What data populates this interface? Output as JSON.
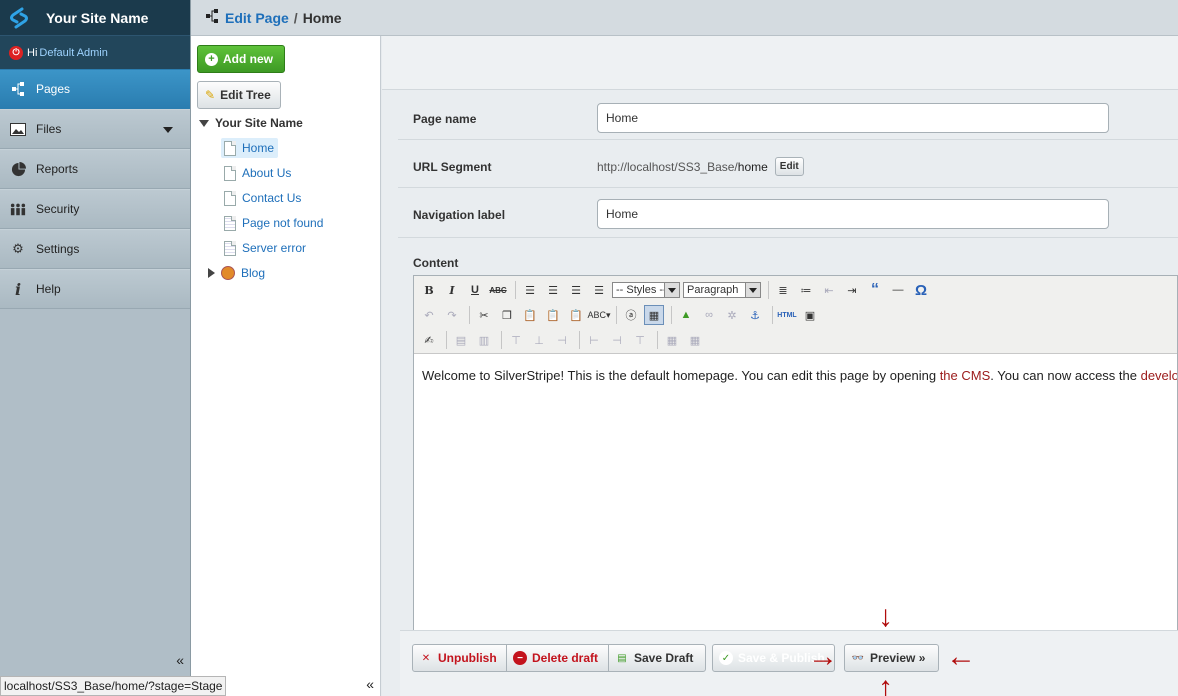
{
  "brand": {
    "site_name": "Your Site Name"
  },
  "user": {
    "greeting": "Hi",
    "name": "Default Admin"
  },
  "menu": [
    {
      "label": "Pages",
      "icon": "sitemap-icon",
      "active": true
    },
    {
      "label": "Files",
      "icon": "image-icon",
      "has_dropdown": true
    },
    {
      "label": "Reports",
      "icon": "pie-chart-icon"
    },
    {
      "label": "Security",
      "icon": "users-icon"
    },
    {
      "label": "Settings",
      "icon": "gear-icon"
    },
    {
      "label": "Help",
      "icon": "info-icon"
    }
  ],
  "collapse_glyph": "«",
  "header": {
    "crumb": "Edit Page",
    "separator": "/",
    "current": "Home"
  },
  "tree": {
    "add_new_label": "Add new",
    "edit_tree_label": "Edit Tree",
    "root_label": "Your Site Name",
    "nodes": [
      {
        "label": "Home",
        "selected": true
      },
      {
        "label": "About Us"
      },
      {
        "label": "Contact Us"
      },
      {
        "label": "Page not found"
      },
      {
        "label": "Server error"
      },
      {
        "label": "Blog"
      }
    ]
  },
  "form": {
    "page_name_label": "Page name",
    "page_name_value": "Home",
    "url_segment_label": "URL Segment",
    "url_base": "http://localhost/SS3_Base/",
    "url_slug": "home",
    "url_edit_label": "Edit",
    "nav_label_label": "Navigation label",
    "nav_label_value": "Home",
    "content_label": "Content"
  },
  "editor": {
    "styles_select": "-- Styles --",
    "format_select": "Paragraph",
    "content_before": "Welcome to SilverStripe! This is the default homepage. You can edit this page by opening ",
    "content_link1": "the CMS",
    "content_middle": ". You can now access the ",
    "content_link2": "developer documentation"
  },
  "actions": {
    "unpublish": "Unpublish",
    "delete_draft": "Delete draft",
    "save_draft": "Save Draft",
    "save_publish": "Save & Publish",
    "preview": "Preview »"
  },
  "status_url": "localhost/SS3_Base/home/?stage=Stage",
  "colors": {
    "accent": "#2a7db0",
    "publish": "#3d9a24",
    "danger": "#c3131d",
    "annotation": "#b00c0c"
  }
}
